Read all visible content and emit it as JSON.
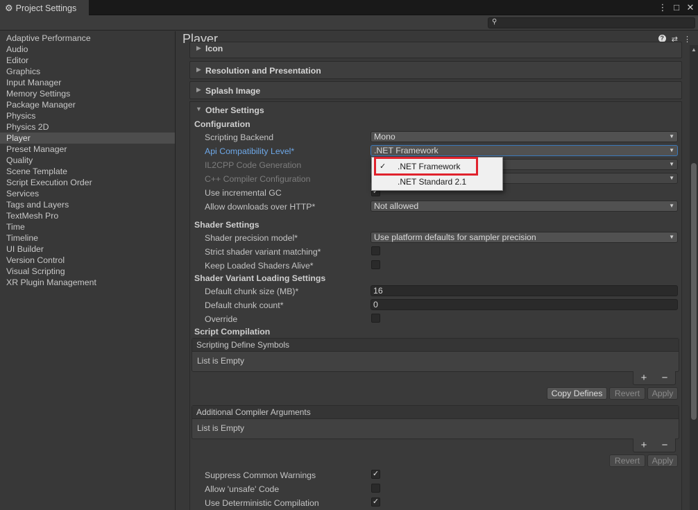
{
  "window": {
    "title": "Project Settings",
    "icon": "gear-icon",
    "controls": [
      "⋮",
      "□",
      "✕"
    ]
  },
  "search": {
    "value": "",
    "placeholder": ""
  },
  "sidebar": {
    "items": [
      "Adaptive Performance",
      "Audio",
      "Editor",
      "Graphics",
      "Input Manager",
      "Memory Settings",
      "Package Manager",
      "Physics",
      "Physics 2D",
      "Player",
      "Preset Manager",
      "Quality",
      "Scene Template",
      "Script Execution Order",
      "Services",
      "Tags and Layers",
      "TextMesh Pro",
      "Time",
      "Timeline",
      "UI Builder",
      "Version Control",
      "Visual Scripting",
      "XR Plugin Management"
    ],
    "active": "Player"
  },
  "main": {
    "title": "Player",
    "foldouts": {
      "icon": "Icon",
      "resolution": "Resolution and Presentation",
      "splash": "Splash Image",
      "other": "Other Settings"
    },
    "configuration": {
      "header": "Configuration",
      "scripting_backend": {
        "label": "Scripting Backend",
        "value": "Mono"
      },
      "api_level": {
        "label": "Api Compatibility Level*",
        "value": ".NET Framework"
      },
      "il2cpp_codegen": {
        "label": "IL2CPP Code Generation"
      },
      "cpp_compiler": {
        "label": "C++ Compiler Configuration"
      },
      "incremental_gc": {
        "label": "Use incremental GC",
        "checked": true
      },
      "allow_http": {
        "label": "Allow downloads over HTTP*",
        "value": "Not allowed"
      }
    },
    "shader": {
      "header": "Shader Settings",
      "precision": {
        "label": "Shader precision model*",
        "value": "Use platform defaults for sampler precision"
      },
      "strict_variant": {
        "label": "Strict shader variant matching*",
        "checked": false
      },
      "keep_loaded": {
        "label": "Keep Loaded Shaders Alive*",
        "checked": false
      }
    },
    "variant_loading": {
      "header": "Shader Variant Loading Settings",
      "chunk_size": {
        "label": "Default chunk size (MB)*",
        "value": "16"
      },
      "chunk_count": {
        "label": "Default chunk count*",
        "value": "0"
      },
      "override": {
        "label": "Override",
        "checked": false
      }
    },
    "compilation": {
      "header": "Script Compilation",
      "define_symbols": {
        "title": "Scripting Define Symbols",
        "empty": "List is Empty"
      },
      "compiler_args": {
        "title": "Additional Compiler Arguments",
        "empty": "List is Empty"
      },
      "plus": "+",
      "minus": "−",
      "copy_defines": "Copy Defines",
      "revert": "Revert",
      "apply": "Apply",
      "suppress_warnings": {
        "label": "Suppress Common Warnings",
        "checked": true
      },
      "allow_unsafe": {
        "label": "Allow 'unsafe' Code",
        "checked": false
      },
      "deterministic": {
        "label": "Use Deterministic Compilation",
        "checked": true
      }
    }
  },
  "popup": {
    "items": [
      {
        "label": ".NET Framework",
        "selected": true
      },
      {
        "label": ".NET Standard 2.1",
        "selected": false
      }
    ],
    "highlight_color": "#e0222d"
  }
}
